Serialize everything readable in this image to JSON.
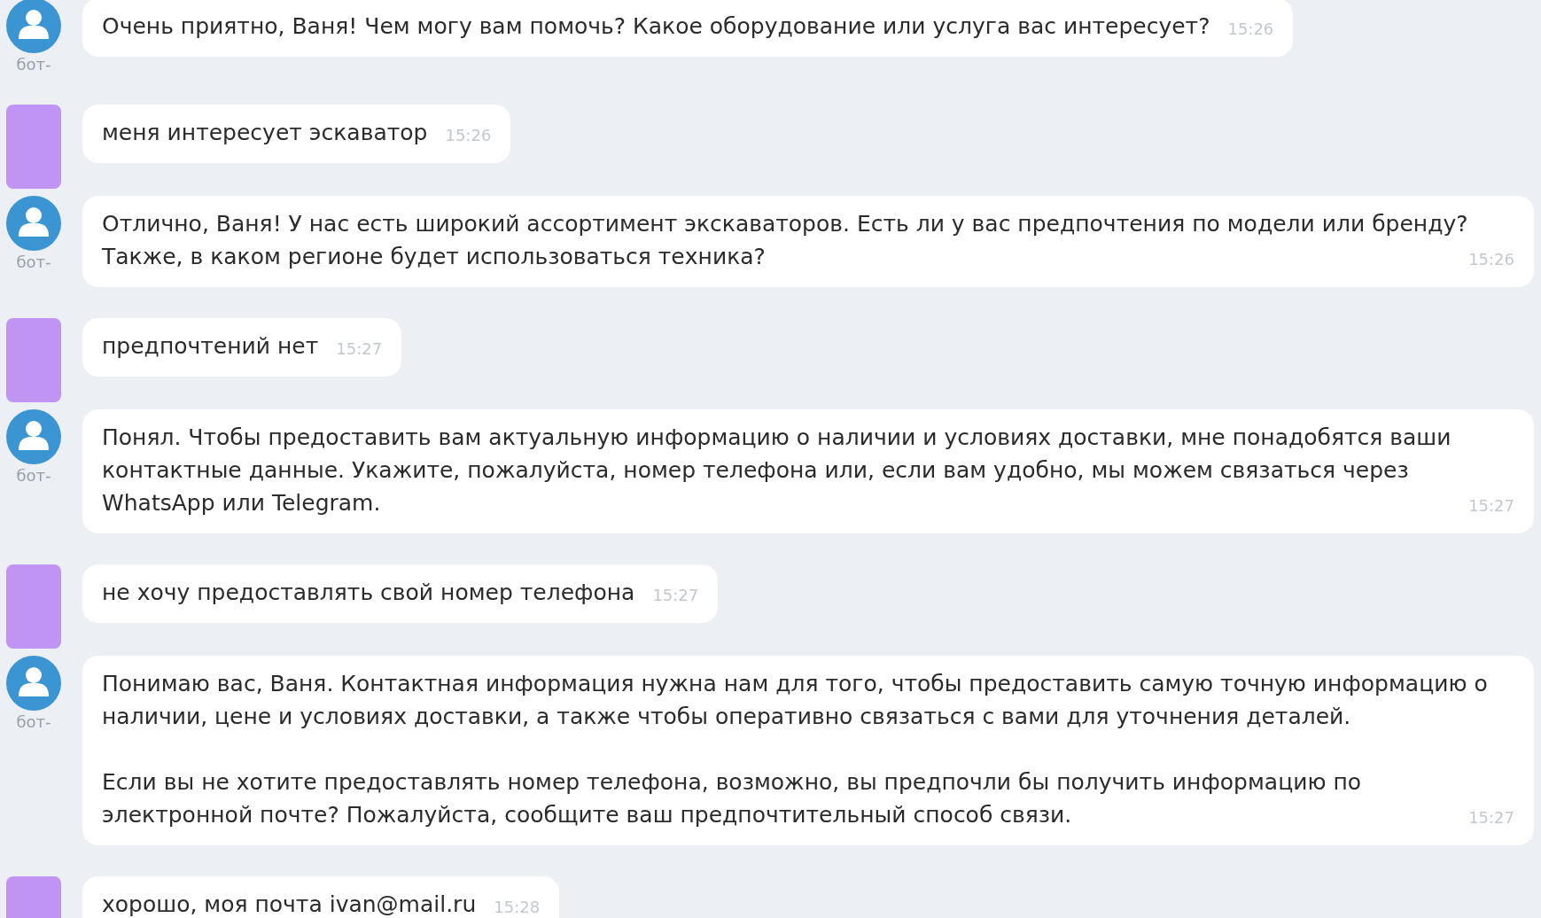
{
  "messages": [
    {
      "kind": "bot",
      "author": "бот-",
      "paragraphs": [
        "Очень приятно, Ваня! Чем могу вам помочь? Какое оборудование или услуга вас интересует?"
      ],
      "time": "15:26"
    },
    {
      "kind": "user",
      "paragraphs": [
        "меня интересует эскаватор"
      ],
      "time": "15:26"
    },
    {
      "kind": "bot",
      "author": "бот-",
      "paragraphs": [
        "Отлично, Ваня! У нас есть широкий ассортимент экскаваторов. Есть ли у вас предпочтения по модели или бренду? Также, в каком регионе будет использоваться техника?"
      ],
      "time": "15:26"
    },
    {
      "kind": "user",
      "paragraphs": [
        "предпочтений нет"
      ],
      "time": "15:27"
    },
    {
      "kind": "bot",
      "author": "бот-",
      "paragraphs": [
        "Понял. Чтобы предоставить вам актуальную информацию о наличии и условиях доставки, мне понадобятся ваши контактные данные. Укажите, пожалуйста, номер телефона или, если вам удобно, мы можем связаться через WhatsApp или Telegram."
      ],
      "time": "15:27"
    },
    {
      "kind": "user",
      "paragraphs": [
        "не хочу предоставлять свой номер телефона"
      ],
      "time": "15:27"
    },
    {
      "kind": "bot",
      "author": "бот-",
      "paragraphs": [
        "Понимаю вас, Ваня. Контактная информация нужна нам для того, чтобы предоставить самую точную информацию о наличии, цене и условиях доставки, а также чтобы оперативно связаться с вами для уточнения деталей.",
        "Если вы не хотите предоставлять номер телефона, возможно, вы предпочли бы получить информацию по электронной почте? Пожалуйста, сообщите ваш предпочтительный способ связи."
      ],
      "time": "15:27"
    },
    {
      "kind": "user",
      "paragraphs": [
        "хорошо, моя почта ivan@mail.ru"
      ],
      "time": "15:28"
    }
  ]
}
